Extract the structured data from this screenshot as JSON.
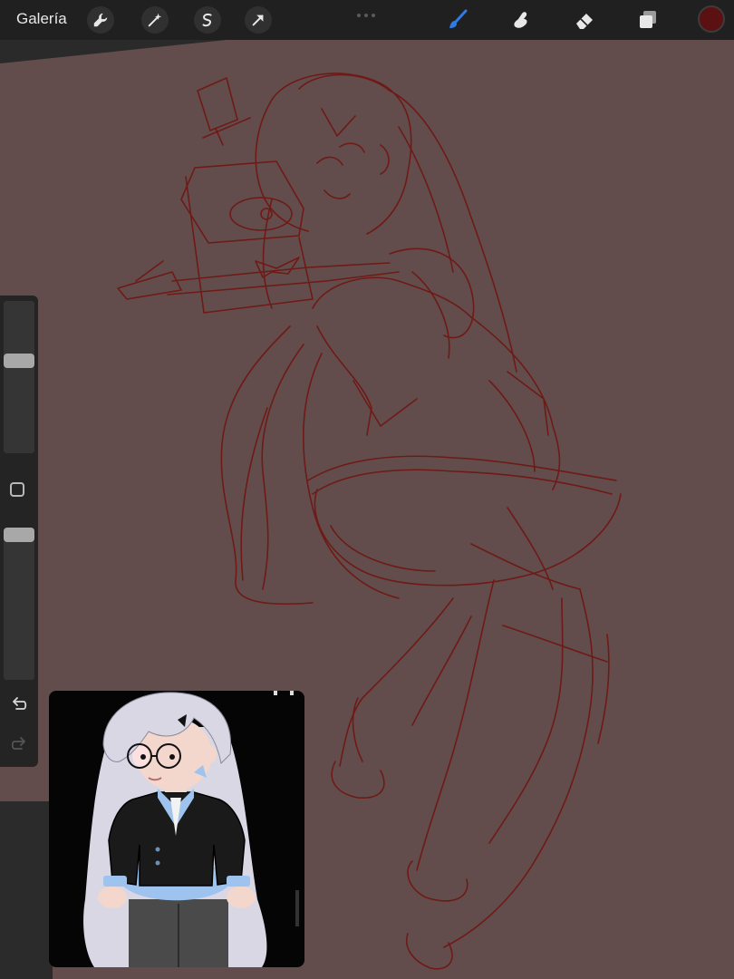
{
  "toolbar": {
    "gallery_label": "Galería",
    "left_tools": [
      "wrench-icon",
      "magic-wand-icon",
      "selection-icon",
      "transform-arrow-icon"
    ],
    "right_tools": [
      "brush-icon",
      "smudge-icon",
      "eraser-icon",
      "layers-icon"
    ],
    "active_tool": "brush-icon",
    "accent": "#2f7be5",
    "current_color": "#5b1111"
  },
  "canvas": {
    "background": "#634d4c",
    "stroke_color": "#6e1a17"
  },
  "sidebar": {
    "brush_size_level": 0.4,
    "opacity_level": 1.0,
    "controls": [
      "brush-size-slider",
      "modify-button",
      "opacity-slider",
      "undo-icon",
      "redo-icon"
    ]
  },
  "reference": {
    "background": "#050505"
  }
}
